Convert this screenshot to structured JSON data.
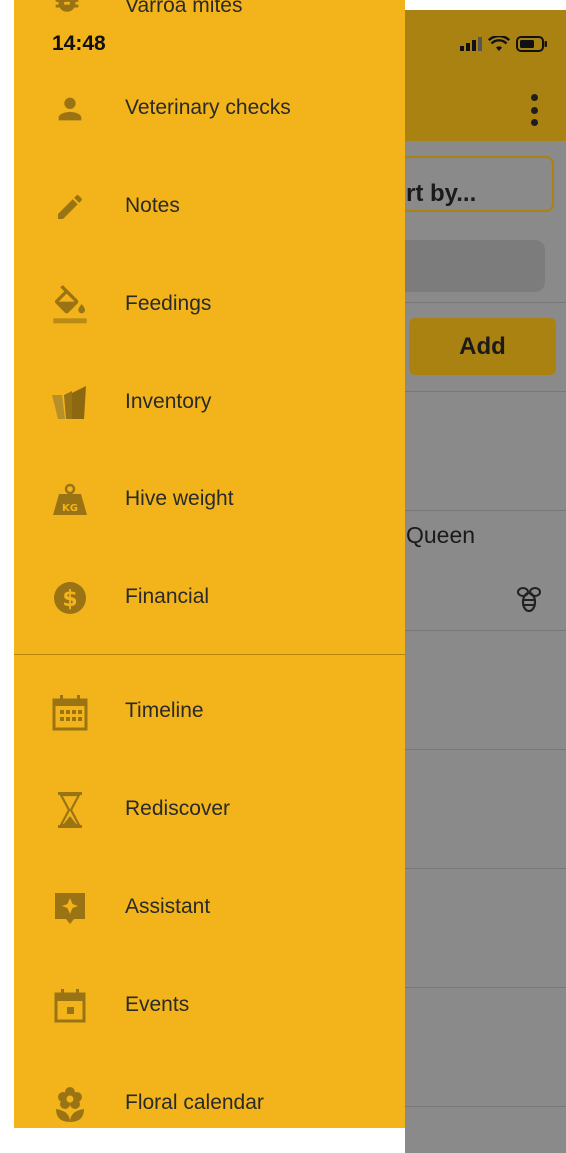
{
  "status_bar": {
    "time": "14:48"
  },
  "background": {
    "sort_label": "rt by...",
    "add_label": "Add",
    "queen_label": "Queen"
  },
  "drawer": {
    "top_item": {
      "label": "Varroa mites",
      "icon": "bug-icon"
    },
    "items": [
      {
        "label": "Veterinary checks",
        "icon": "person-icon"
      },
      {
        "label": "Notes",
        "icon": "pencil-icon"
      },
      {
        "label": "Feedings",
        "icon": "paint-bucket-icon"
      },
      {
        "label": "Inventory",
        "icon": "smoker-icon"
      },
      {
        "label": "Hive weight",
        "icon": "weight-kg-icon"
      },
      {
        "label": "Financial",
        "icon": "dollar-icon"
      },
      {
        "label": "Timeline",
        "icon": "calendar-grid-icon"
      },
      {
        "label": "Rediscover",
        "icon": "hourglass-icon"
      },
      {
        "label": "Assistant",
        "icon": "sparkle-icon"
      },
      {
        "label": "Events",
        "icon": "calendar-icon"
      },
      {
        "label": "Floral calendar",
        "icon": "flower-icon"
      }
    ]
  },
  "colors": {
    "drawer": "#f2b41a",
    "icon": "#9a7414",
    "header": "#a98212",
    "overlay": "#8a8a8a"
  }
}
